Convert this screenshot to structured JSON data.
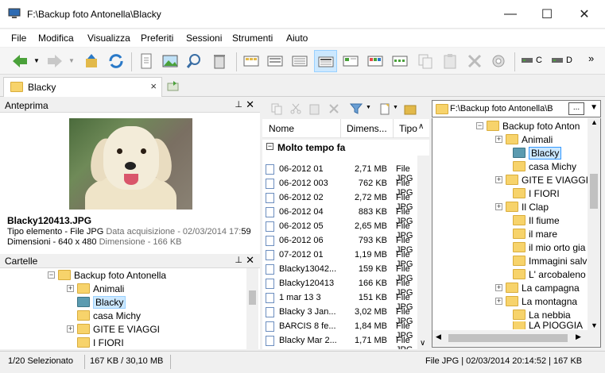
{
  "window": {
    "title": "F:\\Backup foto Antonella\\Blacky",
    "minimize": "—",
    "maximize": "☐",
    "close": "✕"
  },
  "menu": [
    "File",
    "Modifica",
    "Visualizza",
    "Preferiti",
    "Sessioni",
    "Strumenti",
    "Aiuto"
  ],
  "toolbar": {
    "drive_c": "C",
    "drive_d": "D",
    "overflow": "»"
  },
  "tab": {
    "label": "Blacky",
    "close": "×"
  },
  "preview_panel": {
    "title": "Anteprima",
    "pin": "⊥",
    "close": "✕",
    "file_name": "Blacky120413.JPG",
    "type_line": "Tipo elemento - File JPG",
    "acq_label": "Data acquisizione - 02/03/2014 17:",
    "acq_time_end": "59",
    "dims_line": "Dimensioni - 640 x 480",
    "size_line": "Dimensione - 166 KB"
  },
  "folders_panel": {
    "title": "Cartelle",
    "pin": "⊥",
    "close": "✕",
    "items": [
      {
        "label": "Backup foto Antonella",
        "expander": "−"
      },
      {
        "label": "Animali",
        "expander": "+"
      },
      {
        "label": "Blacky",
        "expander": ""
      },
      {
        "label": "casa Michy",
        "expander": ""
      },
      {
        "label": "GITE E VIAGGI",
        "expander": "+"
      },
      {
        "label": "I FIORI",
        "expander": ""
      }
    ]
  },
  "file_list": {
    "columns": [
      "Nome",
      "Dimens...",
      "Tipo"
    ],
    "group": "Molto tempo fa",
    "group_toggle": "−",
    "rows": [
      {
        "name": "06-2012 01",
        "size": "2,71 MB",
        "type": "File JPG"
      },
      {
        "name": "06-2012 003",
        "size": "762 KB",
        "type": "File JPG"
      },
      {
        "name": "06-2012 02",
        "size": "2,72 MB",
        "type": "File JPG"
      },
      {
        "name": "06-2012 04",
        "size": "883 KB",
        "type": "File JPG"
      },
      {
        "name": "06-2012 05",
        "size": "2,65 MB",
        "type": "File JPG"
      },
      {
        "name": "06-2012 06",
        "size": "793 KB",
        "type": "File JPG"
      },
      {
        "name": "07-2012 01",
        "size": "1,19 MB",
        "type": "File JPG"
      },
      {
        "name": "Blacky13042...",
        "size": "159 KB",
        "type": "File JPG"
      },
      {
        "name": "Blacky120413",
        "size": "166 KB",
        "type": "File JPG"
      },
      {
        "name": "1 mar 13 3",
        "size": "151 KB",
        "type": "File JPG"
      },
      {
        "name": "Blacky 3 Jan...",
        "size": "3,02 MB",
        "type": "File JPG"
      },
      {
        "name": "BARCIS 8 fe...",
        "size": "1,84 MB",
        "type": "File JPG"
      },
      {
        "name": "Blacky Mar 2...",
        "size": "1,71 MB",
        "type": "File JPG"
      }
    ]
  },
  "address_bar": {
    "path": "F:\\Backup foto Antonella\\B",
    "more": "..."
  },
  "right_tree": {
    "items": [
      {
        "label": "Backup foto Anton",
        "expander": "−",
        "indent": 0
      },
      {
        "label": "Animali",
        "expander": "+",
        "indent": 1
      },
      {
        "label": "Blacky",
        "expander": "",
        "indent": 1,
        "selected": true
      },
      {
        "label": "casa Michy",
        "expander": "",
        "indent": 1
      },
      {
        "label": "GITE E VIAGGI",
        "expander": "+",
        "indent": 1
      },
      {
        "label": "I FIORI",
        "expander": "",
        "indent": 1
      },
      {
        "label": "Il Clap",
        "expander": "+",
        "indent": 1
      },
      {
        "label": "Il fiume",
        "expander": "",
        "indent": 1
      },
      {
        "label": "il mare",
        "expander": "",
        "indent": 1
      },
      {
        "label": "il mio orto gia",
        "expander": "",
        "indent": 1
      },
      {
        "label": "Immagini salv",
        "expander": "",
        "indent": 1
      },
      {
        "label": "L' arcobaleno",
        "expander": "",
        "indent": 1
      },
      {
        "label": "La campagna",
        "expander": "+",
        "indent": 1
      },
      {
        "label": "La montagna",
        "expander": "+",
        "indent": 1
      },
      {
        "label": "La nebbia",
        "expander": "",
        "indent": 1
      },
      {
        "label": "LA PIOGGIA",
        "expander": "",
        "indent": 1
      }
    ]
  },
  "status": {
    "selected": "1/20 Selezionato",
    "size": "167 KB / 30,10 MB",
    "file_info": "File JPG | 02/03/2014 20:14:52 | 167 KB"
  },
  "colors": {
    "folder": "#f7d36b",
    "selection": "#cce8ff",
    "accent_green": "#4aa13a",
    "accent_blue": "#2a79c8"
  }
}
